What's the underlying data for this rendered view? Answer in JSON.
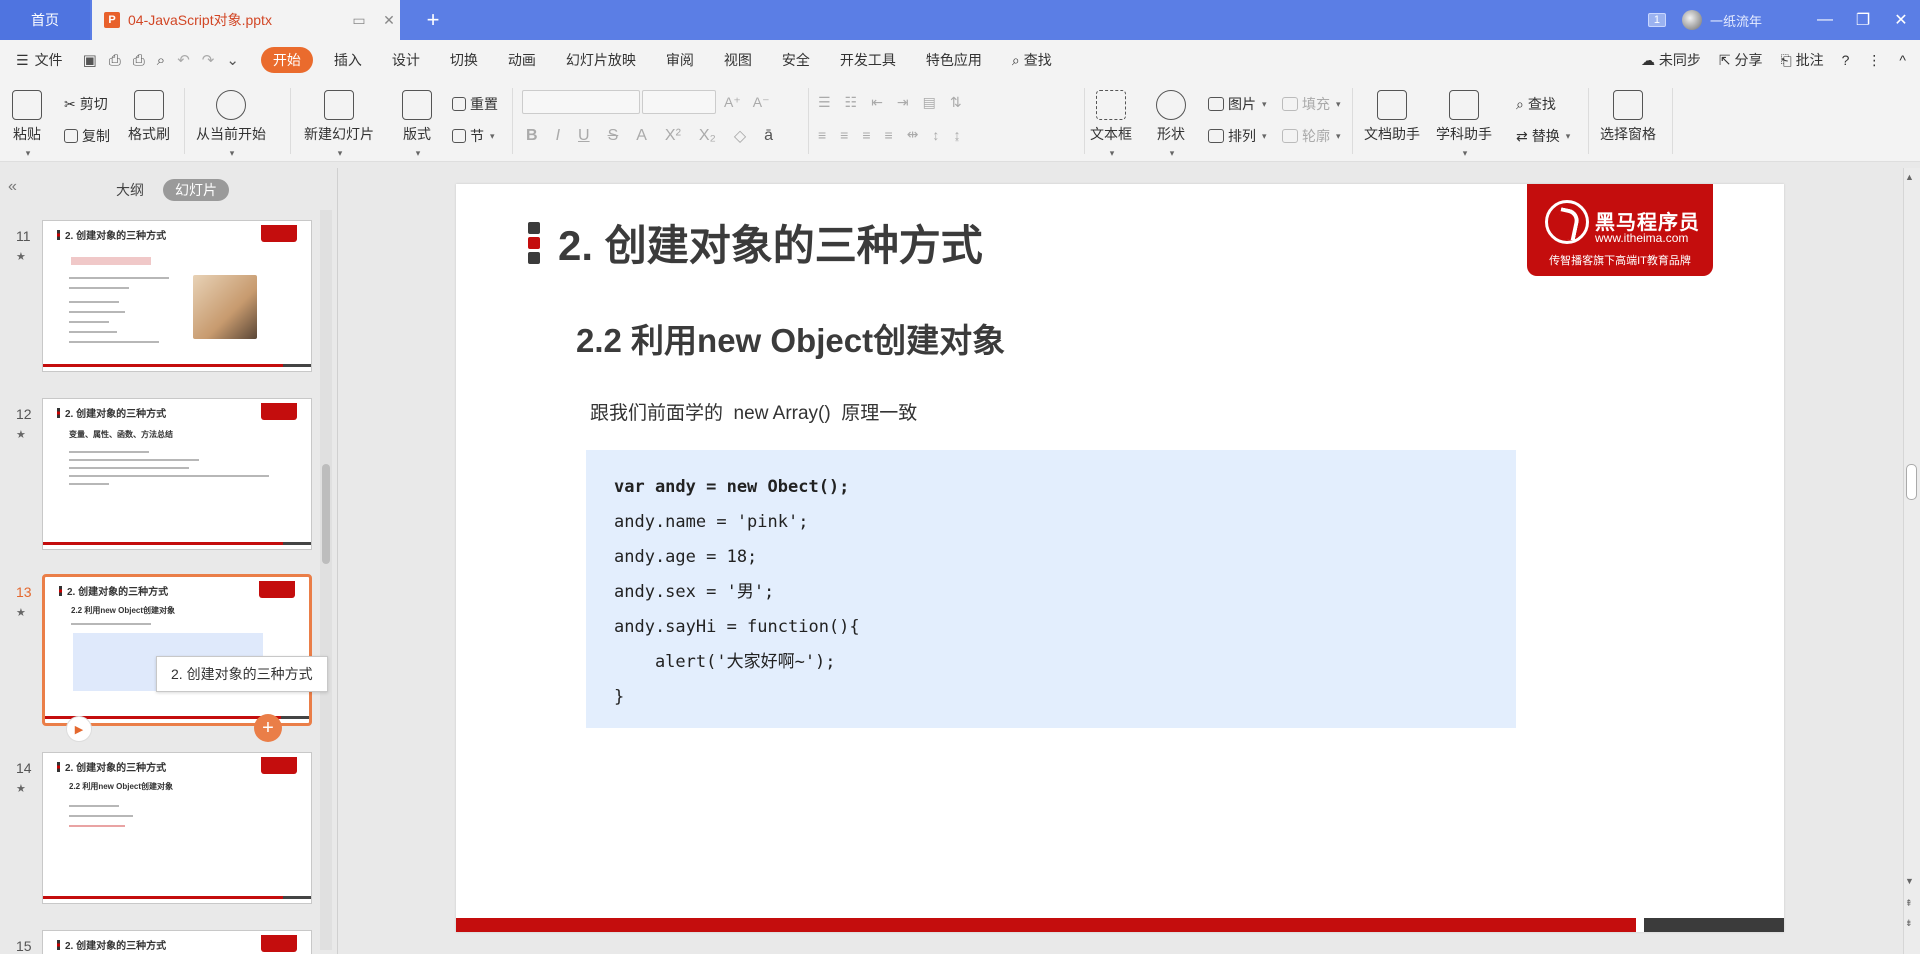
{
  "titlebar": {
    "home_tab": "首页",
    "doc_tab": "04-JavaScript对象.pptx",
    "page_badge": "1",
    "user": "一纸流年"
  },
  "menubar": {
    "file": "文件",
    "tabs": [
      "开始",
      "插入",
      "设计",
      "切换",
      "动画",
      "幻灯片放映",
      "审阅",
      "视图",
      "安全",
      "开发工具",
      "特色应用"
    ],
    "search": "查找",
    "sync": "未同步",
    "share": "分享",
    "comment": "批注"
  },
  "ribbon": {
    "paste": "粘贴",
    "cut": "剪切",
    "copy": "复制",
    "format_painter": "格式刷",
    "from_current": "从当前开始",
    "new_slide": "新建幻灯片",
    "layout": "版式",
    "reset": "重置",
    "section": "节",
    "textbox": "文本框",
    "shape": "形状",
    "picture": "图片",
    "arrange": "排列",
    "fill": "填充",
    "outline": "轮廓",
    "doc_assistant": "文档助手",
    "subject_assistant": "学科助手",
    "find": "查找",
    "replace": "替换",
    "selection_pane": "选择窗格"
  },
  "left_panel": {
    "outline_tab": "大纲",
    "slides_tab": "幻灯片",
    "tooltip": "2. 创建对象的三种方式",
    "thumbnails": [
      {
        "num": "11",
        "title": "2. 创建对象的三种方式"
      },
      {
        "num": "12",
        "title": "2. 创建对象的三种方式",
        "subtitle": "变量、属性、函数、方法总结"
      },
      {
        "num": "13",
        "title": "2. 创建对象的三种方式",
        "subtitle": "2.2 利用new Object创建对象"
      },
      {
        "num": "14",
        "title": "2. 创建对象的三种方式",
        "subtitle": "2.2 利用new Object创建对象"
      },
      {
        "num": "15",
        "title": "2. 创建对象的三种方式"
      }
    ]
  },
  "slide": {
    "title": "2. 创建对象的三种方式",
    "logo": {
      "brand": "黑马程序员",
      "url": "www.itheima.com",
      "slogan": "传智播客旗下高端IT教育品牌"
    },
    "subtitle": "2.2 利用new Object创建对象",
    "text": "跟我们前面学的  new Array()  原理一致",
    "code_lines": [
      "var andy = new Obect();",
      "andy.name = 'pink';",
      "andy.age = 18;",
      "andy.sex = '男';",
      "andy.sayHi = function(){",
      "    alert('大家好啊~');",
      "}"
    ]
  },
  "colors": {
    "titlebar": "#5b7ee5",
    "accent_orange": "#ea6b2d",
    "brand_red": "#c40d0d",
    "code_bg": "#e3eefd"
  }
}
